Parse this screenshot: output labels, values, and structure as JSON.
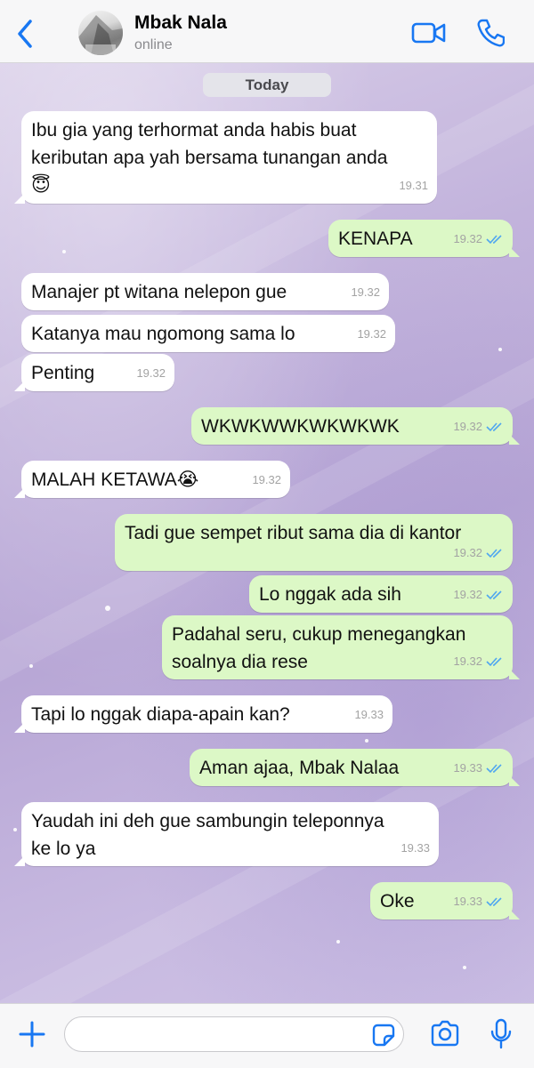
{
  "header": {
    "contact_name": "Mbak Nala",
    "status": "online",
    "icons": {
      "back": "chevron-left-icon",
      "video": "video-camera-icon",
      "call": "phone-icon"
    }
  },
  "colors": {
    "accent": "#1877f2",
    "incoming_bubble": "#ffffff",
    "outgoing_bubble": "#dcf8c6",
    "read_check": "#4fa6f0"
  },
  "chat": {
    "date_label": "Today",
    "messages": [
      {
        "dir": "in",
        "lines": [
          "Ibu gia yang terhormat anda habis buat",
          "keributan apa yah bersama tunangan anda",
          "😇"
        ],
        "time": "19.31"
      },
      {
        "dir": "out",
        "lines": [
          "KENAPA"
        ],
        "time": "19.32",
        "read": true
      },
      {
        "dir": "in",
        "lines": [
          "Manajer pt witana nelepon gue"
        ],
        "time": "19.32"
      },
      {
        "dir": "in",
        "lines": [
          "Katanya mau ngomong sama lo"
        ],
        "time": "19.32"
      },
      {
        "dir": "in",
        "lines": [
          "Penting"
        ],
        "time": "19.32"
      },
      {
        "dir": "out",
        "lines": [
          "WKWKWWKWKWKWK"
        ],
        "time": "19.32",
        "read": true
      },
      {
        "dir": "in",
        "lines": [
          "MALAH KETAWA😭"
        ],
        "time": "19.32"
      },
      {
        "dir": "out",
        "lines": [
          "Tadi gue sempet ribut sama dia di kantor"
        ],
        "time": "19.32",
        "read": true
      },
      {
        "dir": "out",
        "lines": [
          "Lo nggak ada sih"
        ],
        "time": "19.32",
        "read": true
      },
      {
        "dir": "out",
        "lines": [
          "Padahal seru, cukup menegangkan",
          "soalnya dia rese"
        ],
        "time": "19.32",
        "read": true
      },
      {
        "dir": "in",
        "lines": [
          "Tapi lo nggak diapa-apain kan?"
        ],
        "time": "19.33"
      },
      {
        "dir": "out",
        "lines": [
          "Aman ajaa, Mbak Nalaa"
        ],
        "time": "19.33",
        "read": true
      },
      {
        "dir": "in",
        "lines": [
          "Yaudah ini deh gue sambungin teleponnya",
          "ke lo ya"
        ],
        "time": "19.33"
      },
      {
        "dir": "out",
        "lines": [
          "Oke"
        ],
        "time": "19.33",
        "read": true
      }
    ]
  },
  "input_bar": {
    "message_value": "",
    "icons": {
      "add": "plus-icon",
      "sticker": "sticker-icon",
      "camera": "camera-icon",
      "mic": "microphone-icon"
    }
  }
}
